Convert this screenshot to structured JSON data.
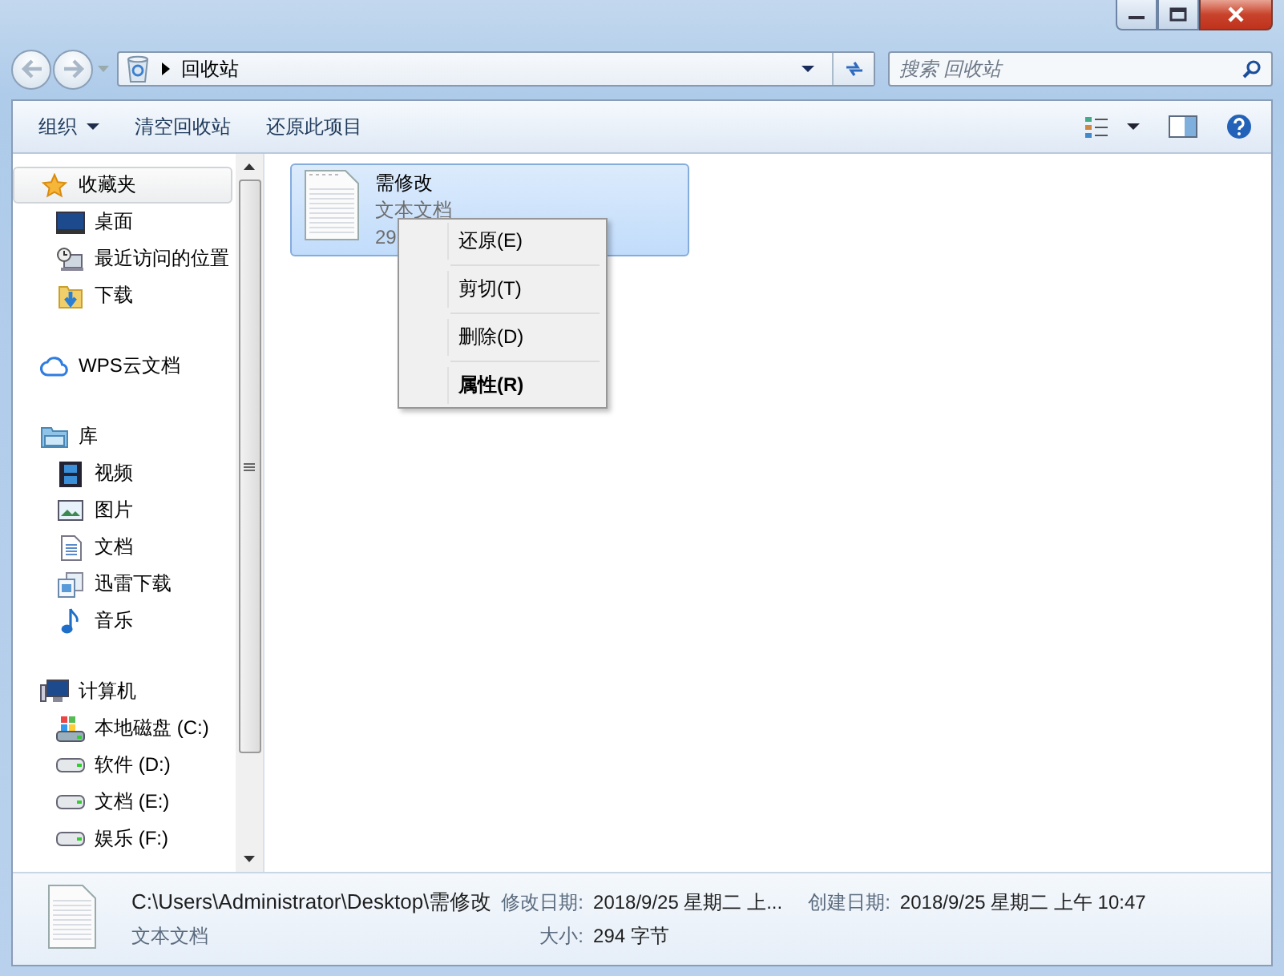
{
  "address_bar": {
    "path": "回收站"
  },
  "search": {
    "placeholder": "搜索 回收站"
  },
  "toolbar": {
    "buttons": [
      {
        "label": "组织",
        "dropdown": true
      },
      {
        "label": "清空回收站",
        "dropdown": false
      },
      {
        "label": "还原此项目",
        "dropdown": false
      }
    ]
  },
  "sidebar": {
    "groups": [
      {
        "label": "收藏夹",
        "kind": "star",
        "selected": true,
        "children": [
          {
            "label": "桌面",
            "kind": "desktop",
            "selected": false
          },
          {
            "label": "最近访问的位置",
            "kind": "recent",
            "selected": false
          },
          {
            "label": "下载",
            "kind": "download",
            "selected": false
          }
        ]
      },
      {
        "label": "WPS云文档",
        "kind": "cloud",
        "selected": false
      },
      {
        "label": "库",
        "kind": "library",
        "selected": false,
        "children": [
          {
            "label": "视频",
            "kind": "video",
            "selected": false
          },
          {
            "label": "图片",
            "kind": "picture",
            "selected": false
          },
          {
            "label": "文档",
            "kind": "document",
            "selected": false
          },
          {
            "label": "迅雷下载",
            "kind": "thunder",
            "selected": false
          },
          {
            "label": "音乐",
            "kind": "music",
            "selected": false
          }
        ]
      },
      {
        "label": "计算机",
        "kind": "computer",
        "selected": false,
        "children": [
          {
            "label": "本地磁盘 (C:)",
            "kind": "system-drive",
            "selected": false
          },
          {
            "label": "软件 (D:)",
            "kind": "drive",
            "selected": false
          },
          {
            "label": "文档 (E:)",
            "kind": "drive",
            "selected": false
          },
          {
            "label": "娱乐 (F:)",
            "kind": "drive",
            "selected": false
          }
        ]
      }
    ]
  },
  "files": [
    {
      "name": "需修改",
      "type": "文本文档",
      "size": "29",
      "selected": true
    }
  ],
  "context_menu": [
    {
      "label": "还原(E)",
      "default": false
    },
    {
      "label": "剪切(T)",
      "default": false
    },
    {
      "label": "删除(D)",
      "default": false
    },
    {
      "label": "属性(R)",
      "default": true
    }
  ],
  "details": {
    "path": "C:\\Users\\Administrator\\Desktop\\需修改",
    "type": "文本文档",
    "fields": [
      {
        "label": "修改日期:",
        "value": "2018/9/25 星期二 上..."
      },
      {
        "label": "创建日期:",
        "value": "2018/9/25 星期二 上午 10:47"
      },
      {
        "label": "大小:",
        "value": "294 字节"
      }
    ]
  }
}
